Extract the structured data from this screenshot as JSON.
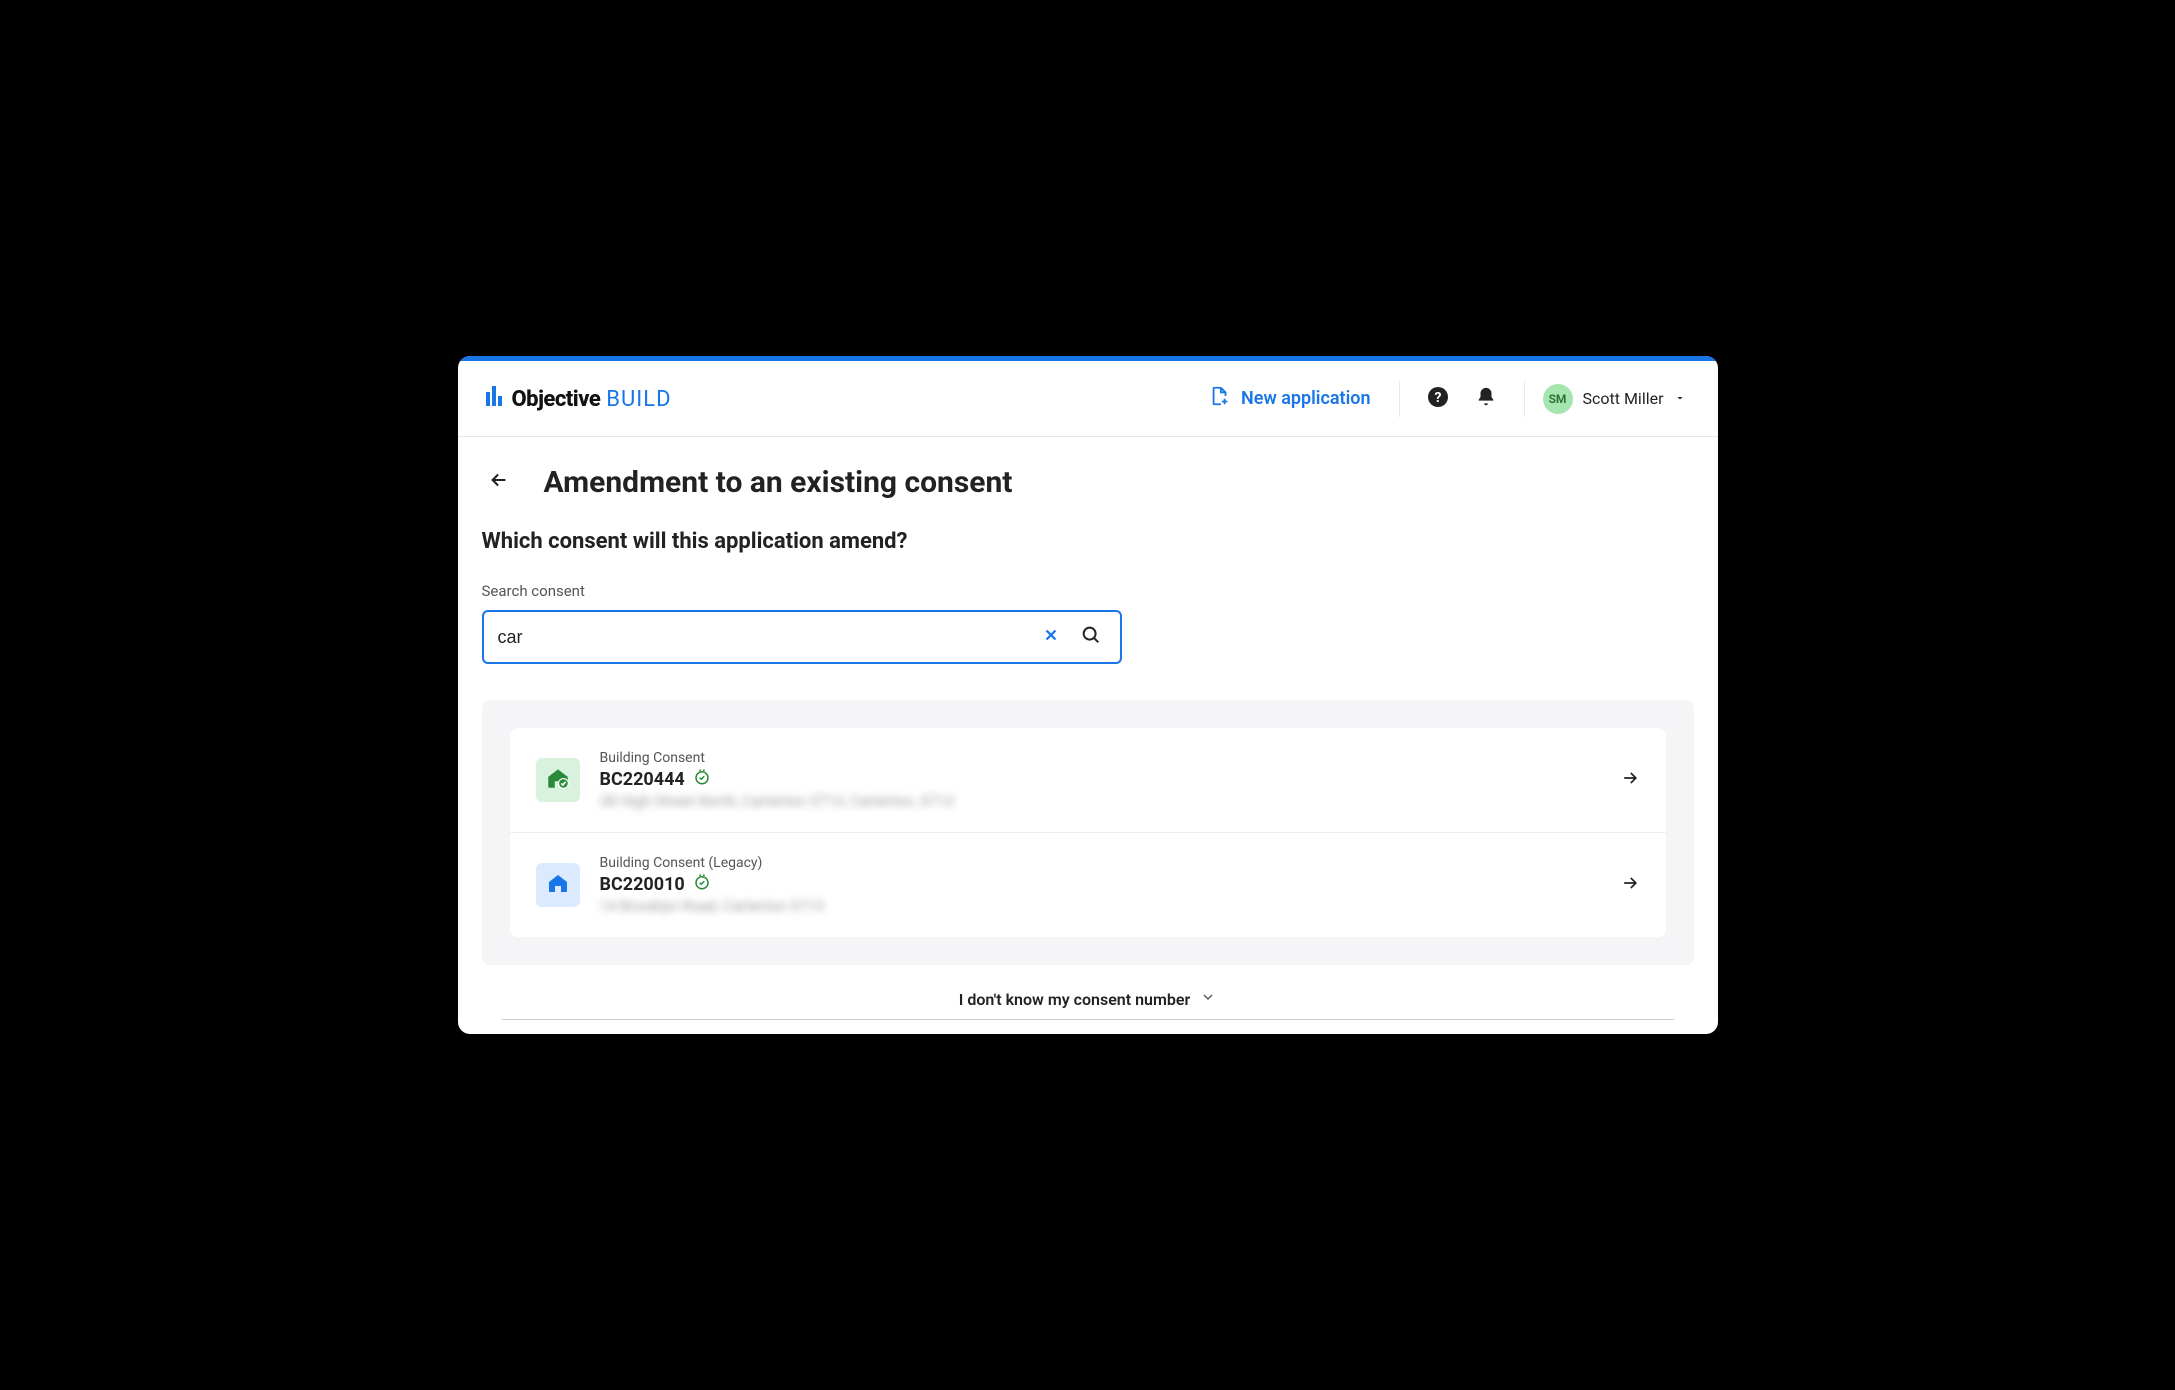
{
  "brand": {
    "word1": "Objective",
    "word2": "BUILD"
  },
  "header": {
    "new_application_label": "New application",
    "user": {
      "initials": "SM",
      "name": "Scott Miller"
    }
  },
  "page": {
    "title": "Amendment to an existing consent",
    "subtitle": "Which consent will this application amend?",
    "search_label": "Search consent",
    "search_value": "car",
    "unknown_link": "I don't know my consent number"
  },
  "results": [
    {
      "type_label": "Building Consent",
      "code": "BC220444",
      "address": "38 High Street North, Carterton 5713, Carterton, 5713",
      "icon_variant": "green"
    },
    {
      "type_label": "Building Consent (Legacy)",
      "code": "BC220010",
      "address": "14 Brooklyn Road, Carterton 5713",
      "icon_variant": "blue"
    }
  ]
}
